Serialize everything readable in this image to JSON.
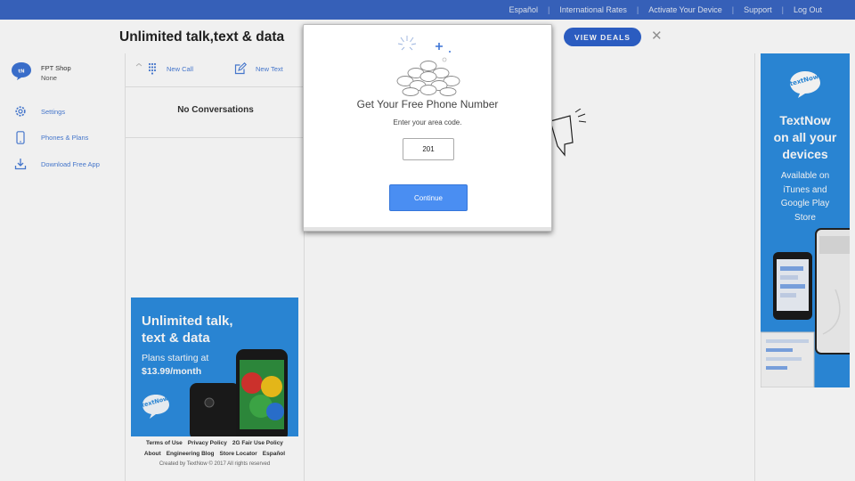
{
  "topnav": [
    "Español",
    "International Rates",
    "Activate Your Device",
    "Support",
    "Log Out"
  ],
  "header": {
    "headline": "Unlimited talk,text & data",
    "deals_label": "VIEW DEALS",
    "close_glyph": "✕"
  },
  "sidebar": {
    "account_name": "FPT Shop",
    "account_sub": "None",
    "items": [
      {
        "label": "Settings",
        "icon": "gear-icon"
      },
      {
        "label": "Phones & Plans",
        "icon": "phone-icon"
      },
      {
        "label": "Download Free App",
        "icon": "download-icon"
      }
    ]
  },
  "conversations": {
    "new_call": "New Call",
    "new_text": "New Text",
    "empty": "No Conversations"
  },
  "ad_left": {
    "line1": "Unlimited talk,",
    "line2": "text & data",
    "plan1": "Plans starting at",
    "plan2": "$13.99/month",
    "brand": "textNow"
  },
  "footer": {
    "row1": [
      "Terms of Use",
      "Privacy Policy",
      "2G Fair Use Policy"
    ],
    "row2": [
      "About",
      "Engineering Blog",
      "Store Locator",
      "Español"
    ],
    "copyright": "Created by TextNow © 2017 All rights reserved"
  },
  "ad_right": {
    "brand": "textNow",
    "h1": "TextNow",
    "h2": "on all your",
    "h3": "devices",
    "p1": "Available on",
    "p2": "iTunes and",
    "p3": "Google Play",
    "p4": "Store"
  },
  "modal": {
    "title": "Get Your Free Phone Number",
    "subtitle": "Enter your area code.",
    "area_code_value": "201",
    "continue_label": "Continue"
  },
  "colors": {
    "topbar": "#3a67c4",
    "accent": "#4a8ef2",
    "ad_blue": "#2c8de0",
    "link": "#4a7ed8"
  }
}
